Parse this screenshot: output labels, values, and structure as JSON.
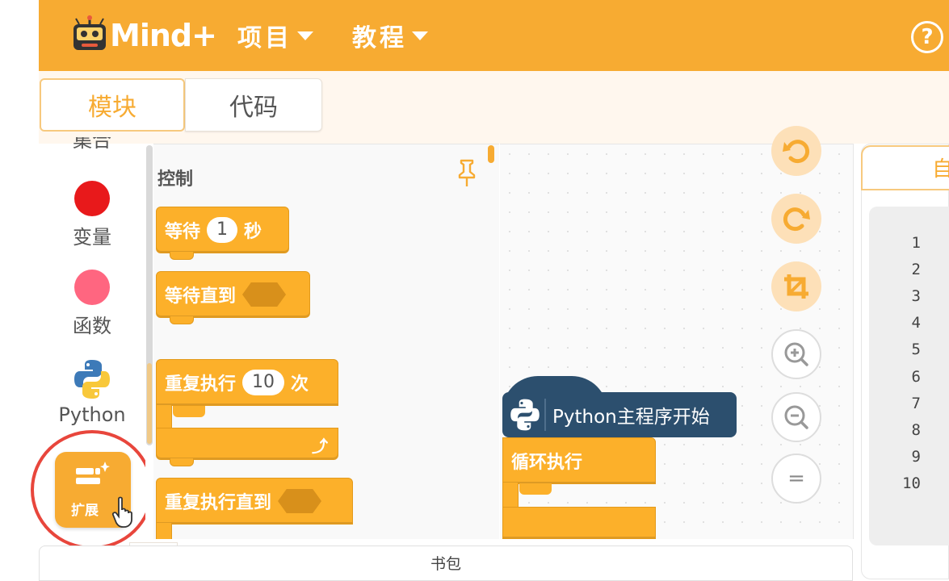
{
  "header": {
    "logo_text": "Mind+",
    "menu_project": "项目",
    "menu_tutorial": "教程",
    "help": "?"
  },
  "view_tabs": {
    "blocks": "模块",
    "code": "代码"
  },
  "categories": {
    "top_partial": "集合",
    "variable": "变量",
    "function": "函数",
    "python": "Python"
  },
  "colors": {
    "accent": "#f7ab32",
    "variable_dot": "#e8191b",
    "function_dot": "#ff6680",
    "python_hat": "#2c4f6e",
    "highlight_circle": "#e8463c"
  },
  "extension": {
    "label": "扩展",
    "ghost_label": "扩展"
  },
  "palette": {
    "title": "控制",
    "wait": {
      "prefix": "等待",
      "value": "1",
      "suffix": "秒"
    },
    "wait_until": "等待直到",
    "repeat": {
      "prefix": "重复执行",
      "value": "10",
      "suffix": "次"
    },
    "repeat_until": "重复执行直到"
  },
  "workspace": {
    "python_start": "Python主程序开始",
    "forever": "循环执行"
  },
  "code_panel": {
    "tab_partial": "自",
    "line_numbers": [
      "1",
      "2",
      "3",
      "4",
      "5",
      "6",
      "7",
      "8",
      "9",
      "10"
    ]
  },
  "backpack": "书包"
}
